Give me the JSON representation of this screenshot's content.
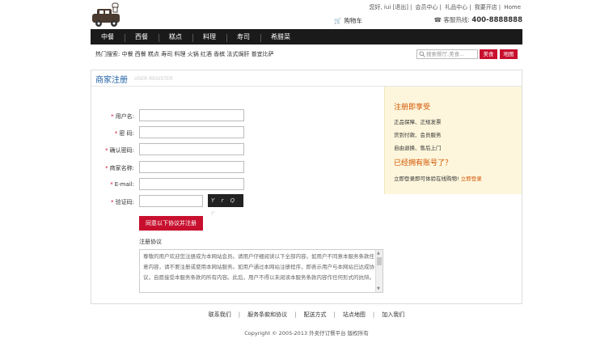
{
  "header": {
    "logo_icon": "chef-car-logo",
    "top_links": [
      "您好, iui [退出]",
      "会员中心",
      "礼品中心",
      "我要开店",
      "Home"
    ],
    "cart_label": "购物车",
    "hotline_label": "客服热线:",
    "hotline_number": "400-8888888"
  },
  "nav": {
    "items": [
      "中餐",
      "西餐",
      "糕点",
      "料理",
      "寿司",
      "希腊菜"
    ]
  },
  "hot_search": {
    "text": "热门搜索: 中餐 西餐 糕点 寿司 料理 火锅 红酒 香槟 法式焗肝 普宜比萨"
  },
  "search": {
    "placeholder": "搜索餐厅,美食...",
    "food_button": "美食",
    "map_button": "地图"
  },
  "form": {
    "title": "商家注册",
    "subtitle": "USER REGISTER",
    "fields": [
      {
        "label": "用户名:"
      },
      {
        "label": "密  码:"
      },
      {
        "label": "确认密码:"
      },
      {
        "label": "商家名称:"
      },
      {
        "label": "E-mail:"
      },
      {
        "label": "验证码:"
      }
    ],
    "captcha_text": "Y r Q P",
    "submit_label": "同意以下协议并注册",
    "terms_title": "注册协议",
    "terms_text": "尊敬的用户欢迎您注册成为本网站会员。请用户仔细阅读以下全部内容。如用户不同意本服务条款任意内容，请不要注册或使用本网站服务。如用户通过本网站注册程序，即表示用户与本网站已达成协议，自愿接受本服务条款的所有内容。此后，用户不得以未阅读本服务条款内容作任何形式的抗辩。"
  },
  "side": {
    "heading1": "注册即享受",
    "benefits": [
      "正品保障、正规发票",
      "货到付款、会员服务",
      "自由退换、售后上门"
    ],
    "heading2": "已经拥有账号了？",
    "login_prompt": "立即登录即可体验在线购物!",
    "login_link": "立即登录"
  },
  "footer": {
    "links": [
      "联系我们",
      "服务条款和协议",
      "配送方式",
      "站点地图",
      "加入我们"
    ],
    "copyright": "Copyright © 2005-2013 外卖仔订餐平台 版权所有"
  },
  "colors": {
    "accent_red": "#c8102e",
    "nav_bg": "#1a1a1a",
    "title_blue": "#1f5fa5",
    "side_bg": "#fdf6dc",
    "side_orange": "#d35400"
  }
}
